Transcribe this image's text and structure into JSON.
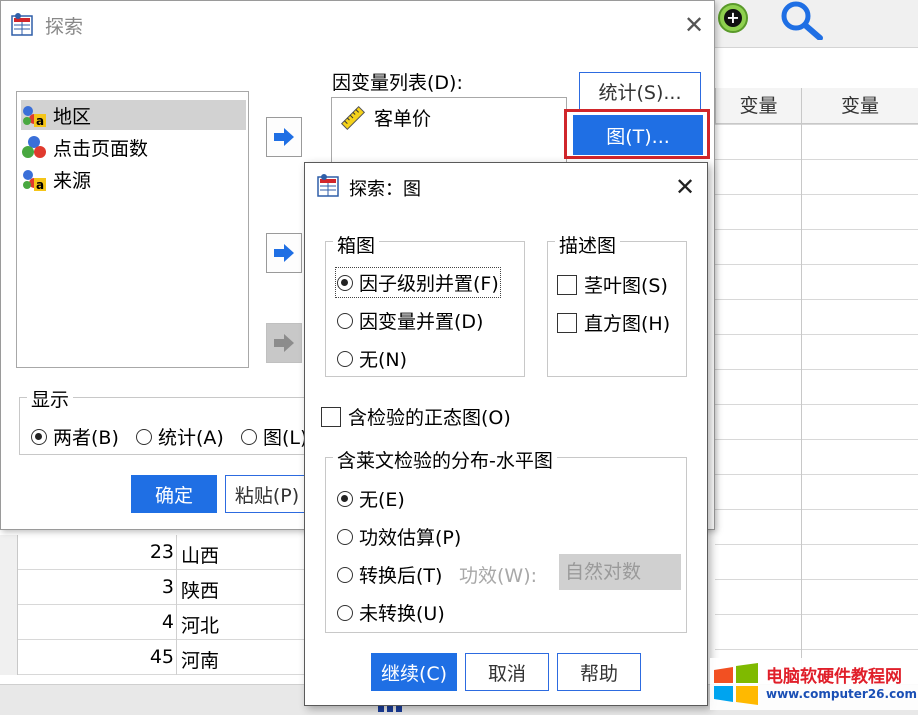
{
  "background": {
    "grid_headers": [
      "变量",
      "变量"
    ],
    "rows": [
      {
        "value": "23",
        "region": "山西"
      },
      {
        "value": "3",
        "region": "陕西"
      },
      {
        "value": "4",
        "region": "河北"
      },
      {
        "value": "45",
        "region": "河南"
      }
    ],
    "icons": {
      "add": "add-icon",
      "search": "search-icon"
    }
  },
  "main_dialog": {
    "title": "探索",
    "variables": [
      "地区",
      "点击页面数",
      "来源"
    ],
    "dependent_list_label": "因变量列表(D):",
    "dependent_items": [
      "客单价"
    ],
    "buttons": {
      "stats": "统计(S)...",
      "plots": "图(T)..."
    },
    "display": {
      "label": "显示",
      "options": [
        "两者(B)",
        "统计(A)",
        "图(L)"
      ],
      "selected": "两者(B)"
    },
    "ok_label": "确定",
    "paste_label": "粘贴(P)"
  },
  "plots_dialog": {
    "title": "探索：图",
    "boxplot": {
      "label": "箱图",
      "options": [
        "因子级别并置(F)",
        "因变量并置(D)",
        "无(N)"
      ],
      "selected": "因子级别并置(F)"
    },
    "descriptive": {
      "label": "描述图",
      "options": [
        "茎叶图(S)",
        "直方图(H)"
      ]
    },
    "normality_label": "含检验的正态图(O)",
    "levene": {
      "label": "含莱文检验的分布-水平图",
      "options": [
        "无(E)",
        "功效估算(P)",
        "转换后(T)",
        "未转换(U)"
      ],
      "selected": "无(E)",
      "power_label": "功效(W):",
      "power_value": "自然对数"
    },
    "continue_label": "继续(C)",
    "cancel_label": "取消",
    "help_label": "帮助"
  },
  "watermark": {
    "title": "电脑软硬件教程网",
    "url": "www.computer26.com"
  },
  "colors": {
    "accent": "#1f6fe4",
    "highlight_frame": "#d0262b",
    "selected_item": "#d2d2d2"
  }
}
